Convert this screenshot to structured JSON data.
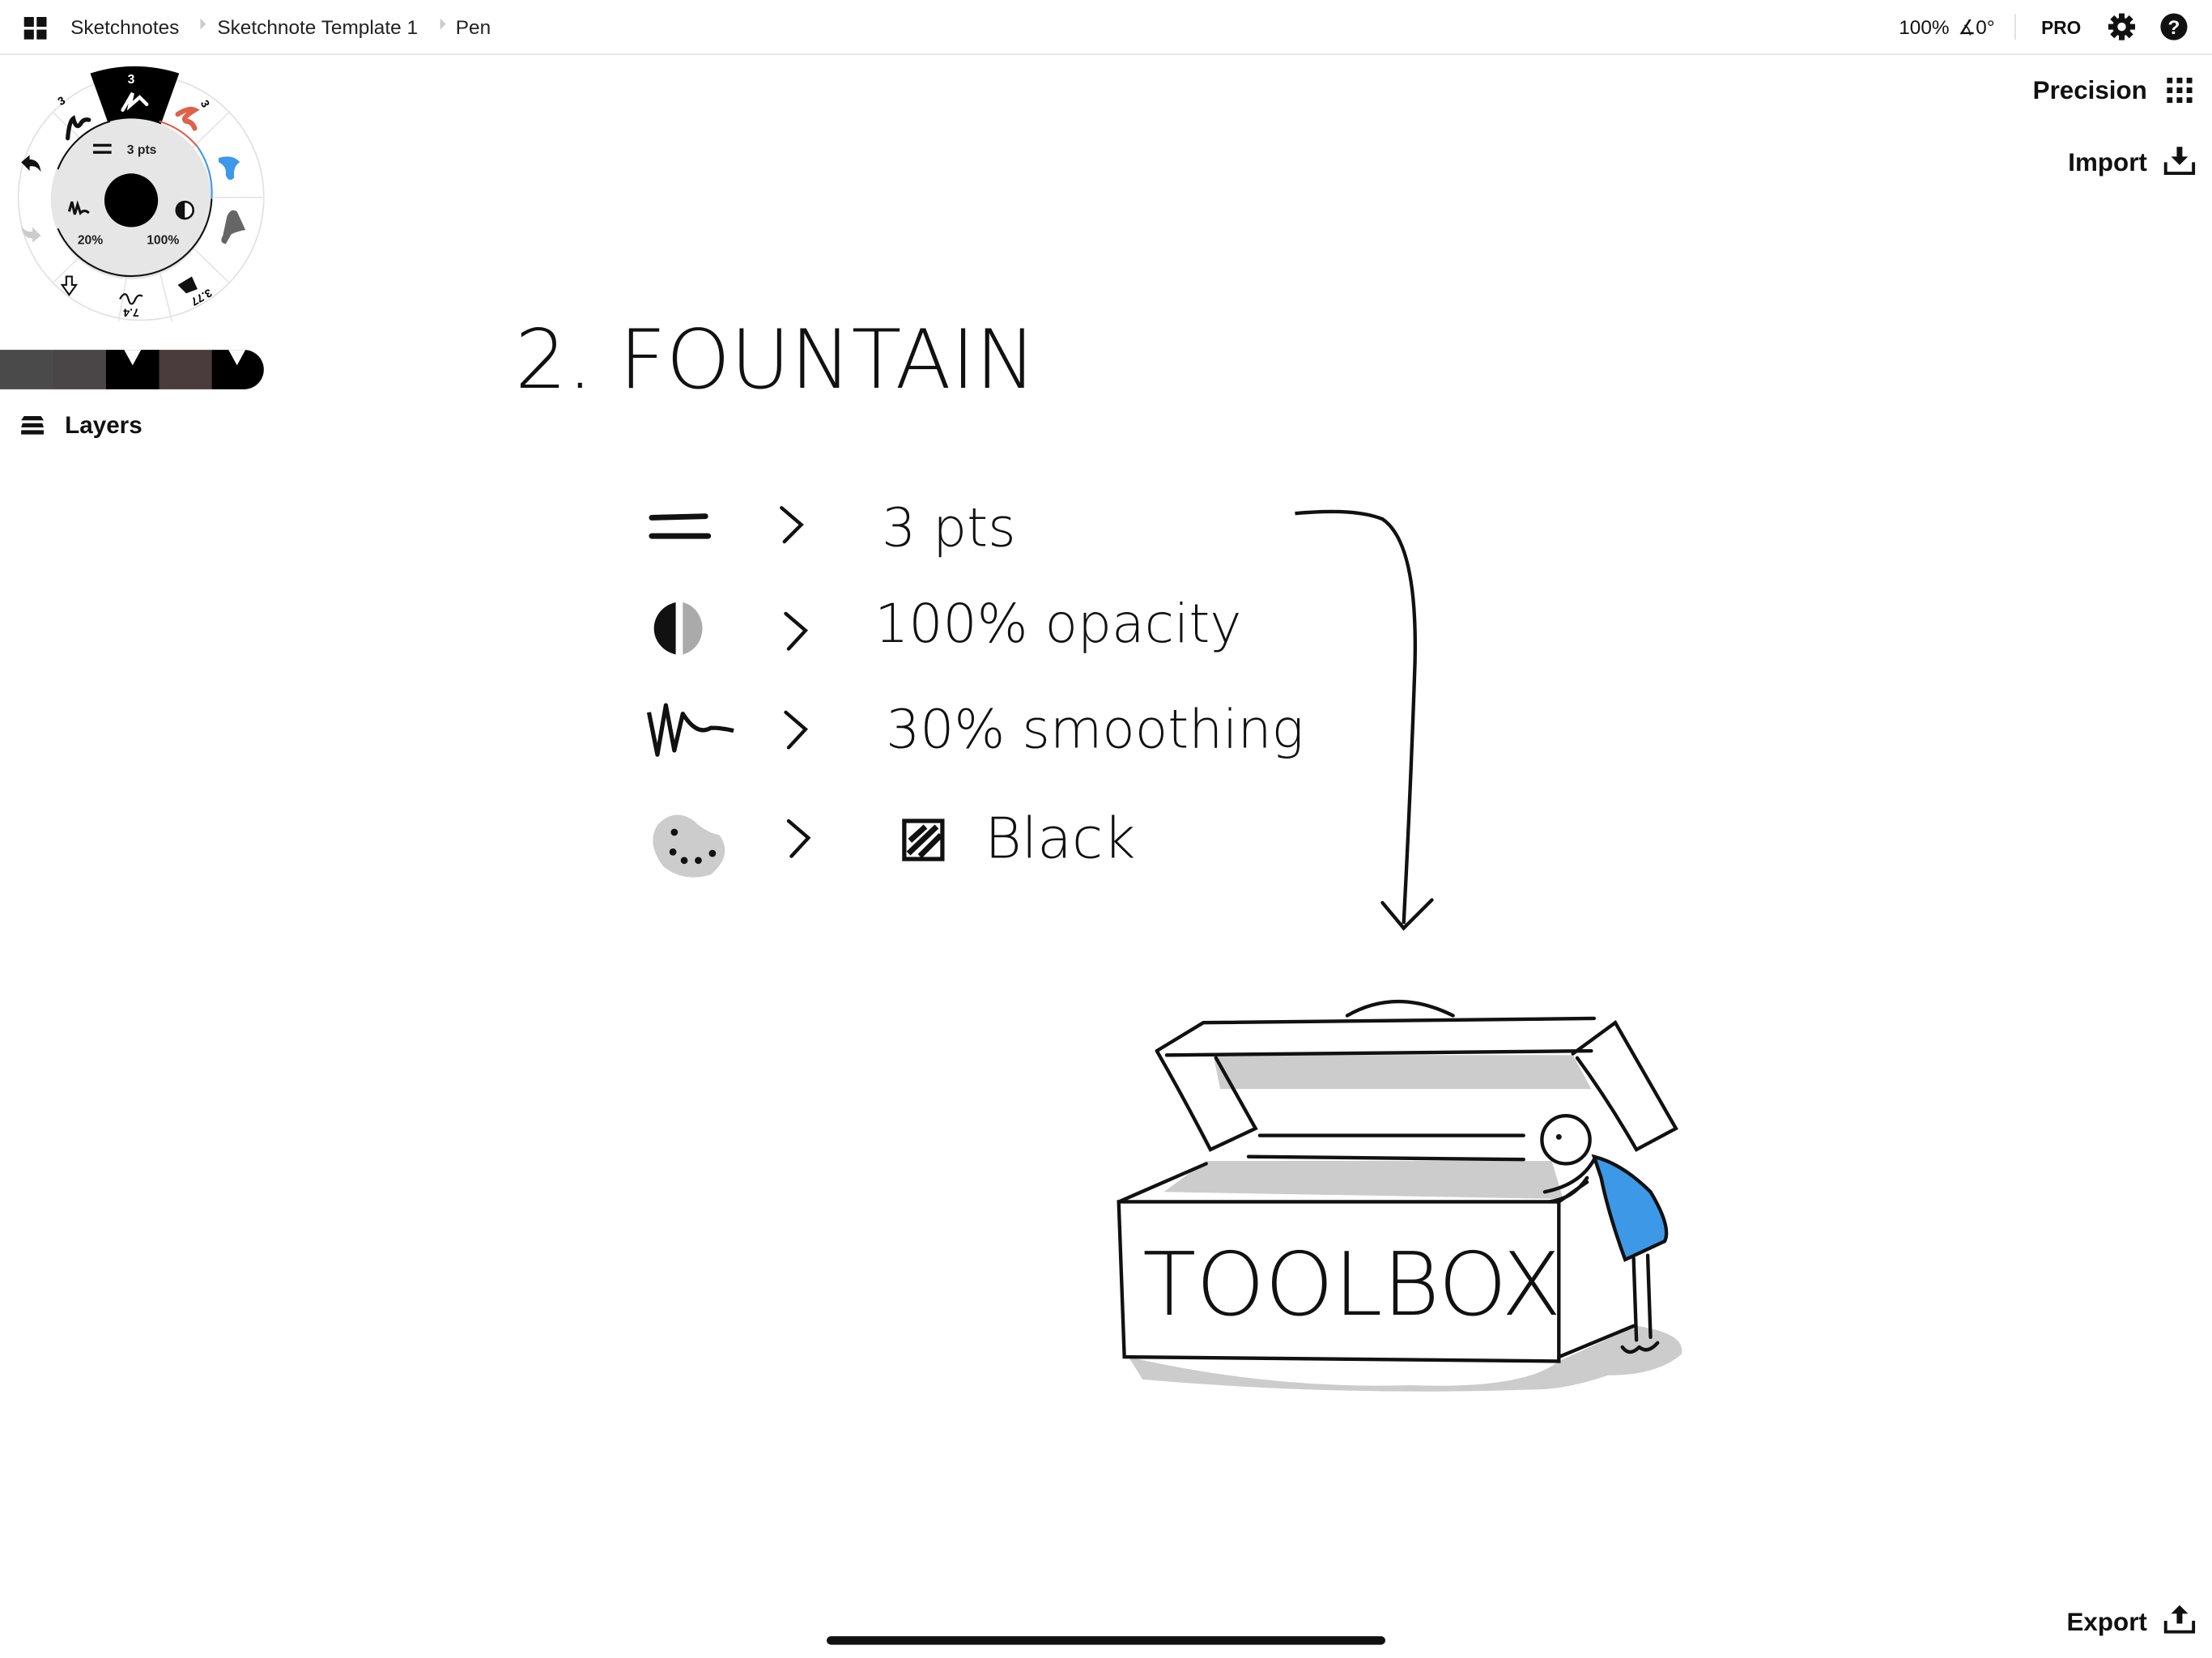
{
  "topbar": {
    "breadcrumbs": [
      "Sketchnotes",
      "Sketchnote Template 1",
      "Pen"
    ],
    "zoom": "100%",
    "rotation": "∡0°",
    "pro_label": "PRO"
  },
  "tool_wheel": {
    "brush_sizes": [
      "3",
      "3",
      "3"
    ],
    "size_label": "3 pts",
    "smoothing_label": "20%",
    "opacity_label": "100%",
    "bottom_values": [
      "7.4",
      "3.77"
    ],
    "colors": {
      "selected": "#000000",
      "red": "#e0604a",
      "blue": "#3d98e8",
      "gray": "#666666"
    }
  },
  "swatches": [
    "#4a4a4a",
    "#4a4546",
    "#000000",
    "#4a3c3c",
    "#000000"
  ],
  "sidebar": {
    "layers_label": "Layers"
  },
  "right_panel": {
    "precision_label": "Precision",
    "import_label": "Import",
    "export_label": "Export"
  },
  "canvas": {
    "title": "2. FOUNTAIN",
    "rows": [
      {
        "icon": "line-weight-icon",
        "text": "3 pts"
      },
      {
        "icon": "opacity-icon",
        "text": "100% opacity"
      },
      {
        "icon": "smoothing-icon",
        "text": "30% smoothing"
      },
      {
        "icon": "palette-icon",
        "text": "Black"
      }
    ],
    "box_label": "TOOLBOX",
    "accent_color": "#3d98e8",
    "shadow_color": "#cccccc"
  }
}
